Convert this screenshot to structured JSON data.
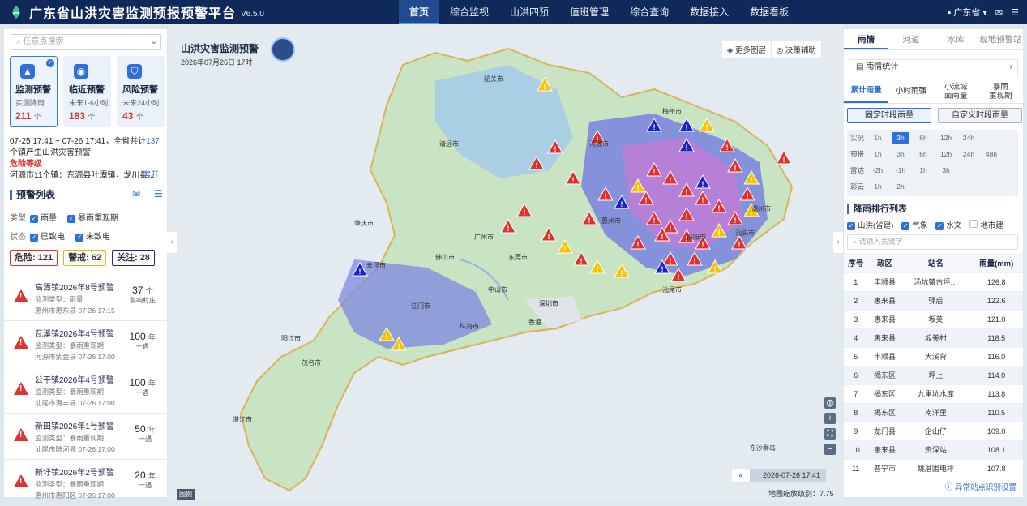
{
  "app": {
    "title": "广东省山洪灾害监测预报预警平台",
    "version": "V6.5.0",
    "region": "广东省"
  },
  "nav": [
    "首页",
    "综合监视",
    "山洪四预",
    "值班管理",
    "综合查询",
    "数据接入",
    "数据看板"
  ],
  "left": {
    "search_placeholder": "任意点搜索",
    "cards": [
      {
        "name": "监测预警",
        "sub": "实测降雨",
        "count": "211",
        "unit": "个"
      },
      {
        "name": "临近预警",
        "sub": "未来1-6小时",
        "count": "183",
        "unit": "个"
      },
      {
        "name": "风险预警",
        "sub": "未来24小时",
        "count": "43",
        "unit": "个"
      }
    ],
    "summary": {
      "line1": "07-25 17:41 ~ 07-26 17:41，全省共计",
      "num": "137",
      "line2": "个镇产生山洪灾害预警",
      "level": "危险等级",
      "line3": "河源市11个镇：东源县叶潭镇，龙川县...",
      "more": "展开"
    },
    "list_title": "预警列表",
    "filter_type_label": "类型",
    "filter_types": [
      "雨量",
      "暴雨重现期"
    ],
    "filter_state_label": "状态",
    "filter_states": [
      "已致电",
      "未致电"
    ],
    "counters": [
      {
        "label": "危险:",
        "value": "121"
      },
      {
        "label": "警戒:",
        "value": "62"
      },
      {
        "label": "关注:",
        "value": "28"
      }
    ],
    "warnings": [
      {
        "title": "高潭镇2026年8号预警",
        "type": "监测类型：雨量",
        "loc": "惠州市惠东县 07-26 17:15",
        "val": "37",
        "unit": "个",
        "sub": "影响村庄"
      },
      {
        "title": "瓦溪镇2026年4号预警",
        "type": "监测类型：暴雨重现期",
        "loc": "河源市紫金县 07-26 17:00",
        "val": "100",
        "unit": "年",
        "sub": "一遇"
      },
      {
        "title": "公平镇2026年4号预警",
        "type": "监测类型：暴雨重现期",
        "loc": "汕尾市海丰县 07-26 17:00",
        "val": "100",
        "unit": "年",
        "sub": "一遇"
      },
      {
        "title": "新田镇2026年1号预警",
        "type": "监测类型：暴雨重现期",
        "loc": "汕尾市陆河县 07-26 17:00",
        "val": "50",
        "unit": "年",
        "sub": "一遇"
      },
      {
        "title": "新圩镇2026年2号预警",
        "type": "监测类型：暴雨重现期",
        "loc": "惠州市惠阳区 07-26 17:00",
        "val": "20",
        "unit": "年",
        "sub": "一遇"
      }
    ]
  },
  "map": {
    "title": "山洪灾害监测预警",
    "date": "2026年07月26日 17时",
    "buttons": [
      "更多图层",
      "决策辅助"
    ],
    "time": "2026-07-26 17:41",
    "zoom": "地图缩放级别：7.75",
    "legend": "图例",
    "labels": [
      "湛江市",
      "阳江市",
      "茂名市",
      "肇庆市",
      "清远市",
      "韶关市",
      "河源市",
      "梅州市",
      "潮州市",
      "汕头市",
      "揭阳市",
      "汕尾市",
      "惠州市",
      "东莞市",
      "深圳市",
      "广州市",
      "佛山市",
      "江门市",
      "珠海市",
      "中山市",
      "云浮市",
      "香港",
      "东沙群岛"
    ]
  },
  "right": {
    "tabs": [
      "雨情",
      "河道",
      "水库",
      "现地预警站"
    ],
    "stat": "雨情统计",
    "subtabs": [
      "累计雨量",
      "小时雨强",
      "小流域\n面雨量",
      "暴雨\n重现期"
    ],
    "btns": [
      "固定时段雨量",
      "自定义时段雨量"
    ],
    "grid": [
      {
        "label": "实况",
        "items": [
          "1h",
          "3h",
          "6h",
          "12h",
          "24h"
        ]
      },
      {
        "label": "预报",
        "items": [
          "1h",
          "3h",
          "6h",
          "12h",
          "24h",
          "48h"
        ]
      },
      {
        "label": "雷达",
        "items": [
          "-2h",
          "-1h",
          "1h",
          "3h"
        ]
      },
      {
        "label": "彩云",
        "items": [
          "1h",
          "2h"
        ]
      }
    ],
    "rank_title": "降雨排行列表",
    "rank_filters": [
      "山洪(省建)",
      "气象",
      "水文",
      "地市建"
    ],
    "keyword_placeholder": "请输入关键字",
    "columns": [
      "序号",
      "政区",
      "站名",
      "雨量(mm)"
    ],
    "rows": [
      [
        "1",
        "丰顺县",
        "汤坑镇古坪…",
        "126.8"
      ],
      [
        "2",
        "惠来县",
        "驿后",
        "122.6"
      ],
      [
        "3",
        "惠来县",
        "坂美",
        "121.0"
      ],
      [
        "4",
        "惠来县",
        "坂美村",
        "118.5"
      ],
      [
        "5",
        "丰顺县",
        "大溪背",
        "116.0"
      ],
      [
        "6",
        "揭东区",
        "坪上",
        "114.0"
      ],
      [
        "7",
        "揭东区",
        "九重坑水库",
        "113.8"
      ],
      [
        "8",
        "揭东区",
        "南洋里",
        "110.5"
      ],
      [
        "9",
        "龙门县",
        "企山仔",
        "109.0"
      ],
      [
        "10",
        "惠来县",
        "资深站",
        "108.1"
      ],
      [
        "11",
        "普宁市",
        "姚厝围电排",
        "107.8"
      ]
    ],
    "footer": "异常站点识别设置"
  },
  "colors": {
    "header": "#0f2a5a",
    "accent": "#2f6fdb",
    "danger": "#e0312e",
    "warning": "#f5c400",
    "notice": "#1a22c9"
  }
}
